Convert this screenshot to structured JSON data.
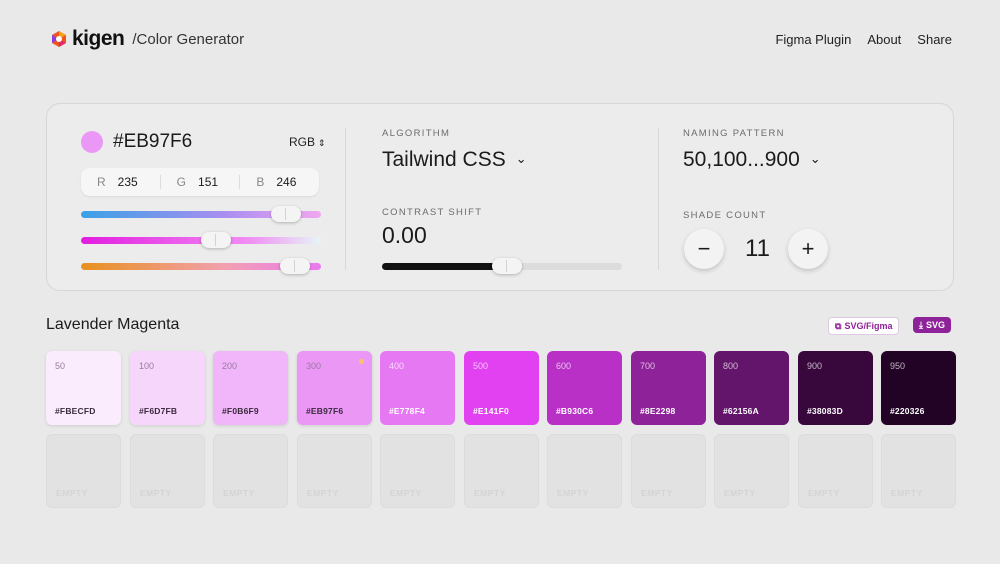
{
  "header": {
    "logo_text": "kigen",
    "page_crumb": "/Color Generator",
    "nav": [
      "Figma Plugin",
      "About",
      "Share"
    ]
  },
  "color_input": {
    "hex": "#EB97F6",
    "mode": "RGB",
    "rgb": {
      "r_label": "R",
      "r": "235",
      "g_label": "G",
      "g": "151",
      "b_label": "B",
      "b": "246"
    },
    "slider_levels": {
      "r": 235,
      "g": 151,
      "b": 246,
      "max": 255
    }
  },
  "algorithm": {
    "label": "ALGORITHM",
    "value": "Tailwind CSS"
  },
  "contrast": {
    "label": "CONTRAST SHIFT",
    "value": "0.00",
    "slider_fraction": 0.5
  },
  "naming": {
    "label": "NAMING PATTERN",
    "value": "50,100...900"
  },
  "shade_count": {
    "label": "SHADE COUNT",
    "value": "11",
    "decrement": "−",
    "increment": "+"
  },
  "palette": {
    "name": "Lavender Magenta",
    "export_figma_label": "SVG/Figma",
    "export_svg_label": "SVG",
    "shades": [
      {
        "shade": "50",
        "hex": "#FBECFD"
      },
      {
        "shade": "100",
        "hex": "#F6D7FB"
      },
      {
        "shade": "200",
        "hex": "#F0B6F9"
      },
      {
        "shade": "300",
        "hex": "#EB97F6"
      },
      {
        "shade": "400",
        "hex": "#E778F4"
      },
      {
        "shade": "500",
        "hex": "#E141F0"
      },
      {
        "shade": "600",
        "hex": "#B930C6"
      },
      {
        "shade": "700",
        "hex": "#8E2298"
      },
      {
        "shade": "800",
        "hex": "#62156A"
      },
      {
        "shade": "900",
        "hex": "#38083D"
      },
      {
        "shade": "950",
        "hex": "#220326"
      }
    ],
    "base_shade": "300",
    "empty_label": "EMPTY"
  },
  "colors": {
    "accent": "#8E2298",
    "background": "#E9E9E9"
  }
}
